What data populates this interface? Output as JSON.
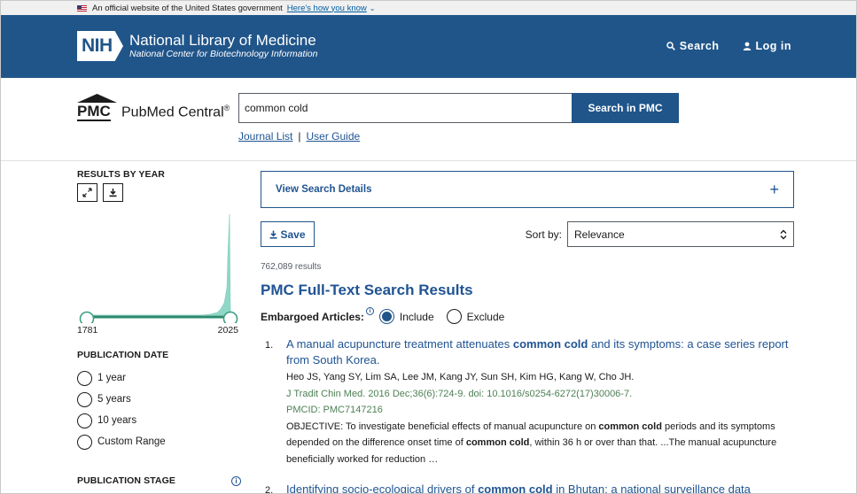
{
  "gov_banner": {
    "text": "An official website of the United States government",
    "link": "Here's how you know"
  },
  "nih": {
    "badge": "NIH",
    "title": "National Library of Medicine",
    "subtitle": "National Center for Biotechnology Information",
    "search_label": "Search",
    "login_label": "Log in"
  },
  "pmc": {
    "letters": "PMC",
    "name": "PubMed Central",
    "reg": "®",
    "search_value": "common cold",
    "search_button": "Search in PMC",
    "journal_list": "Journal List",
    "separator": "|",
    "user_guide": "User Guide"
  },
  "sidebar": {
    "results_by_year": "RESULTS BY YEAR",
    "year_start": "1781",
    "year_end": "2025",
    "publication_date": "PUBLICATION DATE",
    "date_options": [
      "1 year",
      "5 years",
      "10 years",
      "Custom Range"
    ],
    "publication_stage": "PUBLICATION STAGE"
  },
  "main": {
    "view_search_details": "View Search Details",
    "save_label": "Save",
    "sort_label": "Sort by:",
    "sort_value": "Relevance",
    "results_count": "762,089 results",
    "results_title": "PMC Full-Text Search Results",
    "embargo_label": "Embargoed Articles:",
    "include_label": "Include",
    "exclude_label": "Exclude"
  },
  "results": [
    {
      "num": "1.",
      "title_pre": "A manual acupuncture treatment attenuates ",
      "title_bold": "common cold",
      "title_post": " and its symptoms: a case series report from South Korea.",
      "authors": "Heo JS, Yang SY, Lim SA, Lee JM, Kang JY, Sun SH, Kim HG, Kang W, Cho JH.",
      "journal": "J Tradit Chin Med. 2016 Dec;36(6):724-9. doi: 10.1016/s0254-6272(17)30006-7.",
      "pmcid": "PMCID: PMC7147216",
      "abs_1": "OBJECTIVE: To investigate beneficial effects of manual acupuncture on ",
      "abs_b1": "common cold",
      "abs_2": " periods and its symptoms depended on the difference onset time of ",
      "abs_b2": "common cold",
      "abs_3": ", within 36 h or over than that. ...The manual acupuncture beneficially worked for reduction …"
    },
    {
      "num": "2.",
      "title_pre": "Identifying socio-ecological drivers of ",
      "title_bold": "common cold",
      "title_post": " in Bhutan: a national surveillance data"
    }
  ],
  "chart_data": {
    "type": "area",
    "x_range": [
      1781,
      2025
    ],
    "color": "#8fd8c8",
    "note_shape": "flat near zero until late spike at 2025"
  },
  "colors": {
    "brand": "#20558a",
    "link": "#205493",
    "journal": "#4d8055"
  }
}
